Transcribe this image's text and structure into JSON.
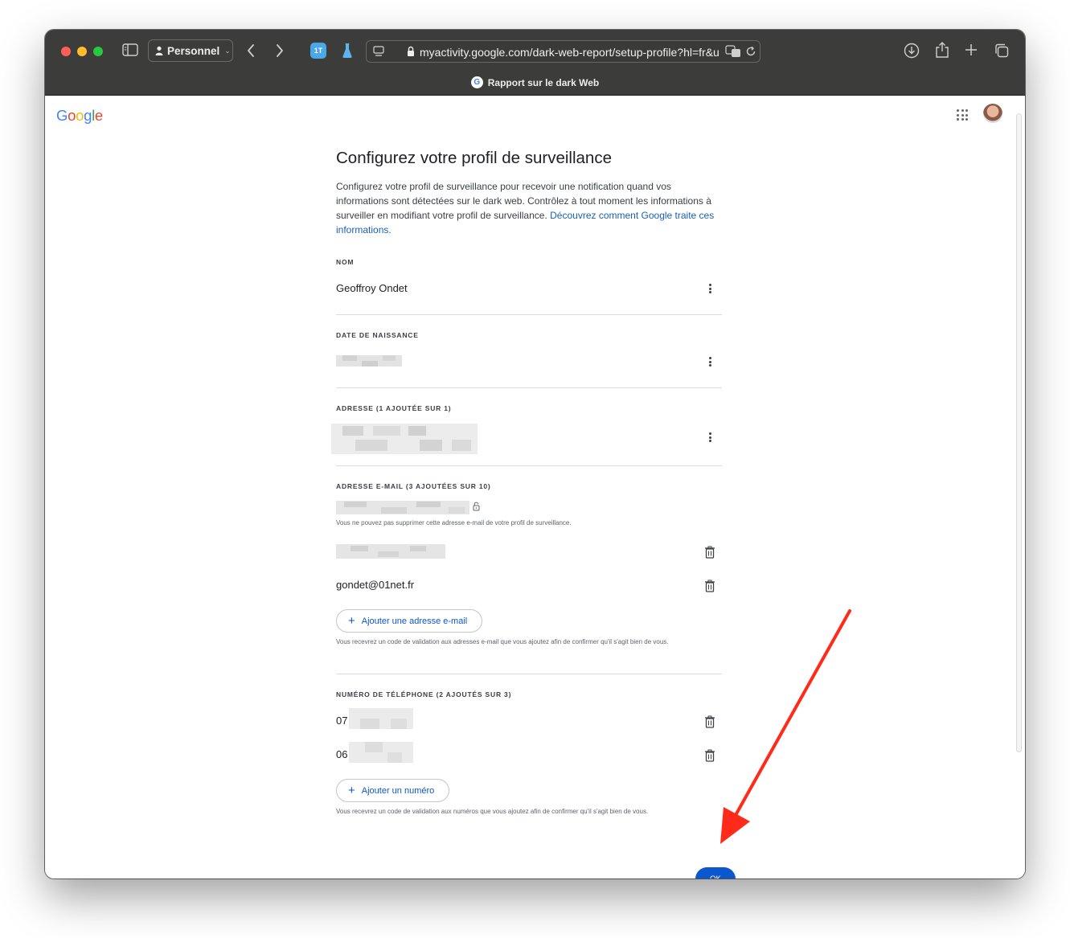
{
  "browser": {
    "profile_label": "Personnel",
    "url": "myactivity.google.com/dark-web-report/setup-profile?hl=fr&u",
    "tab_title": "Rapport sur le dark Web",
    "extension_badge": "1T",
    "icons": [
      "sidebar-icon",
      "person-icon",
      "back-icon",
      "forward-icon",
      "flask-icon",
      "page-icon",
      "lock-icon",
      "translate-icon",
      "reload-icon",
      "download-icon",
      "share-icon",
      "new-tab-icon",
      "tabs-overview-icon"
    ]
  },
  "header": {
    "logo": "Google"
  },
  "page": {
    "title": "Configurez votre profil de surveillance",
    "intro_text": "Configurez votre profil de surveillance pour recevoir une notification quand vos informations sont détectées sur le dark web. Contrôlez à tout moment les informations à surveiller en modifiant votre profil de surveillance.",
    "intro_link": "Découvrez comment Google traite ces informations."
  },
  "sections": {
    "name": {
      "label": "NOM",
      "value": "Geoffroy Ondet"
    },
    "birthdate": {
      "label": "DATE DE NAISSANCE"
    },
    "address": {
      "label": "ADRESSE (1 AJOUTÉE SUR 1)"
    },
    "email": {
      "label": "ADRESSE E-MAIL (3 AJOUTÉES SUR 10)",
      "locked_note": "Vous ne pouvez pas supprimer cette adresse e-mail de votre profil de surveillance.",
      "visible_email": "gondet@01net.fr",
      "add_button": "Ajouter une adresse e-mail",
      "validation_note": "Vous recevrez un code de validation aux adresses e-mail que vous ajoutez afin de confirmer qu'il s'agit bien de vous."
    },
    "phone": {
      "label": "NUMÉRO DE TÉLÉPHONE (2 AJOUTÉS SUR 3)",
      "numbers": [
        {
          "prefix": "07"
        },
        {
          "prefix": "06"
        }
      ],
      "add_button": "Ajouter un numéro",
      "validation_note": "Vous recevrez un code de validation aux numéros que vous ajoutez afin de confirmer qu'il s'agit bien de vous."
    }
  },
  "actions": {
    "ok_label": "OK"
  },
  "colors": {
    "accent": "#0b57d0",
    "link": "#1a5fb4",
    "annotation_arrow": "#ff2a1a",
    "titlebar": "#3c3c3a"
  }
}
